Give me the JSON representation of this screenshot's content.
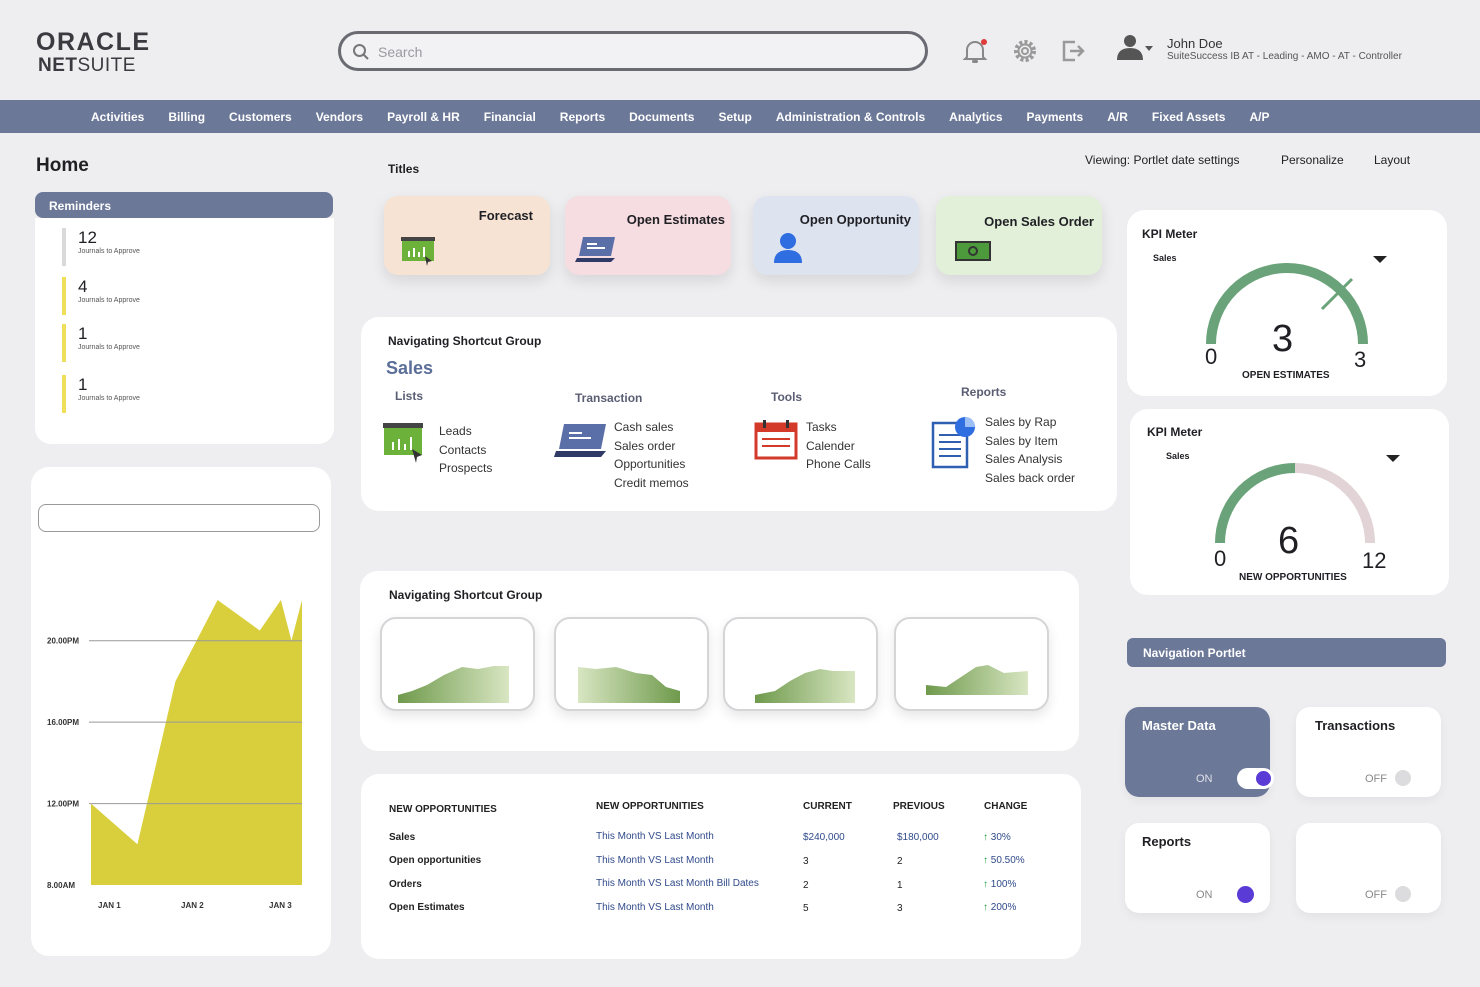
{
  "brand": {
    "line1": "ORACLE",
    "line2_bold": "NET",
    "line2_rest": "SUITE"
  },
  "search": {
    "placeholder": "Search"
  },
  "user": {
    "name": "John Doe",
    "subtitle": "SuiteSuccess IB AT - Leading - AMO - AT - Controller"
  },
  "nav": [
    "Activities",
    "Billing",
    "Customers",
    "Vendors",
    "Payroll & HR",
    "Financial",
    "Reports",
    "Documents",
    "Setup",
    "Administration & Controls",
    "Analytics",
    "Payments",
    "A/R",
    "Fixed Assets",
    "A/P"
  ],
  "page": {
    "title": "Home",
    "titles_label": "Titles",
    "viewing": "Viewing: Portlet date settings",
    "personalize": "Personalize",
    "layout": "Layout"
  },
  "reminders": {
    "header": "Reminders",
    "items": [
      {
        "count": "12",
        "label": "Journals to Approve",
        "color": "#d9d9d9"
      },
      {
        "count": "4",
        "label": "Journals to Approve",
        "color": "#efdf5a"
      },
      {
        "count": "1",
        "label": "Journals to Approve",
        "color": "#efdf5a"
      },
      {
        "count": "1",
        "label": "Journals to Approve",
        "color": "#efdf5a"
      }
    ]
  },
  "tiles": [
    {
      "title": "Forecast",
      "bg": "#f6e3d3"
    },
    {
      "title": "Open Estimates",
      "bg": "#f6dde1"
    },
    {
      "title": "Open Opportunity",
      "bg": "#dde3ef"
    },
    {
      "title": "Open Sales Order",
      "bg": "#e2f0d9"
    }
  ],
  "shortcut_group": {
    "title": "Navigating Shortcut Group",
    "section": "Sales",
    "columns": [
      {
        "head": "Lists",
        "items": [
          "Leads",
          "Contacts",
          "Prospects"
        ]
      },
      {
        "head": "Transaction",
        "items": [
          "Cash sales",
          "Sales order",
          "Opportunities",
          "Credit memos"
        ]
      },
      {
        "head": "Tools",
        "items": [
          "Tasks",
          "Calender",
          "Phone Calls"
        ]
      },
      {
        "head": "Reports",
        "items": [
          "Sales by Rap",
          "Sales by Item",
          "Sales Analysis",
          "Sales back order"
        ]
      }
    ]
  },
  "shortcut_group2": {
    "title": "Navigating Shortcut Group"
  },
  "table": {
    "headers": [
      "NEW OPPORTUNITIES",
      "NEW OPPORTUNITIES",
      "CURRENT",
      "PREVIOUS",
      "CHANGE"
    ],
    "rows": [
      {
        "name": "Sales",
        "period": "This Month  VS Last Month",
        "current": "$240,000",
        "previous": "$180,000",
        "change": "30%"
      },
      {
        "name": "Open opportunities",
        "period": "This Month  VS Last Month",
        "current": "3",
        "previous": "2",
        "change": "50.50%"
      },
      {
        "name": "Orders",
        "period": "This Month  VS Last Month Bill Dates",
        "current": "2",
        "previous": "1",
        "change": "100%"
      },
      {
        "name": "Open Estimates",
        "period": "This Month  VS Last Month",
        "current": "5",
        "previous": "3",
        "change": "200%"
      }
    ]
  },
  "kpi": [
    {
      "title": "KPI Meter",
      "select": "Sales",
      "value": "3",
      "min": "0",
      "max": "3",
      "label": "OPEN ESTIMATES",
      "fraction": 1.0
    },
    {
      "title": "KPI Meter",
      "select": "Sales",
      "value": "6",
      "min": "0",
      "max": "12",
      "label": "NEW OPPORTUNITIES",
      "fraction": 0.5
    }
  ],
  "navigation_portlet": {
    "header": "Navigation Portlet",
    "toggles": [
      {
        "title": "Master Data",
        "state": "ON",
        "on": true
      },
      {
        "title": "Transactions",
        "state": "OFF",
        "on": false
      },
      {
        "title": "Reports",
        "state": "ON",
        "on": true
      },
      {
        "title": "",
        "state": "OFF",
        "on": false
      }
    ]
  },
  "colors": {
    "nav": "#6c7898",
    "accent": "#5b3bd6",
    "gauge": "#6aa37a",
    "area": "#d9cf3c"
  },
  "chart_data": {
    "type": "area",
    "x": [
      "JAN 1",
      "JAN 2",
      "JAN 3"
    ],
    "y_ticks": [
      "8.00AM",
      "12.00PM",
      "16.00PM",
      "20.00PM"
    ],
    "y_values": [
      12.0,
      10.0,
      18.0,
      22.0,
      20.5,
      22.0,
      20.0,
      22.0
    ],
    "x_positions": [
      0,
      0.22,
      0.4,
      0.6,
      0.8,
      0.9,
      0.95,
      1.0
    ],
    "ylim": [
      8,
      22
    ]
  }
}
